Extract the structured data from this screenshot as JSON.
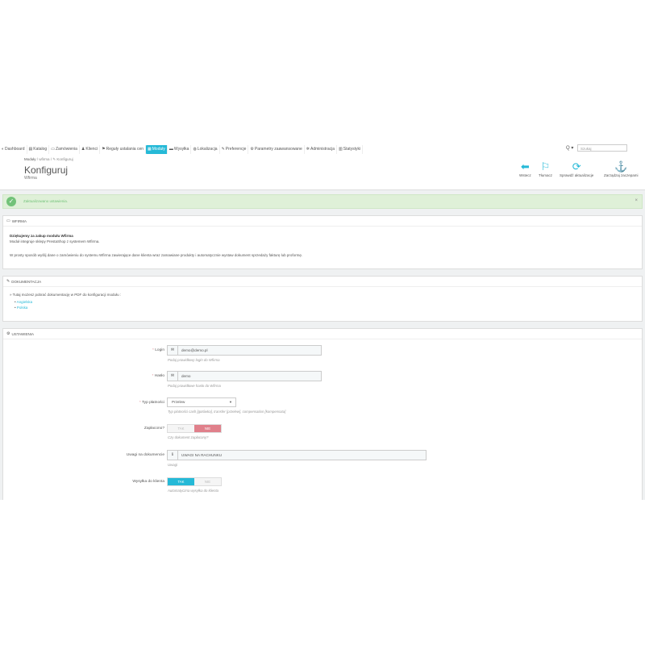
{
  "nav": {
    "items": [
      {
        "icon": "dashboard-icon",
        "glyph": "◐",
        "label": "Dashboard"
      },
      {
        "icon": "catalog-icon",
        "glyph": "▤",
        "label": "Katalog"
      },
      {
        "icon": "orders-icon",
        "glyph": "▭",
        "label": "Zamówienia"
      },
      {
        "icon": "customers-icon",
        "glyph": "♟",
        "label": "Klienci"
      },
      {
        "icon": "price-rules-icon",
        "glyph": "⚑",
        "label": "Reguły ustalania cen"
      },
      {
        "icon": "modules-icon",
        "glyph": "▦",
        "label": "Moduły"
      },
      {
        "icon": "shipping-icon",
        "glyph": "▬",
        "label": "Wysyłka"
      },
      {
        "icon": "localization-icon",
        "glyph": "◍",
        "label": "Lokalizacja"
      },
      {
        "icon": "preferences-icon",
        "glyph": "✎",
        "label": "Preferencje"
      },
      {
        "icon": "advanced-params-icon",
        "glyph": "⚙",
        "label": "Parametry zaawansowane"
      },
      {
        "icon": "administration-icon",
        "glyph": "✲",
        "label": "Administracja"
      },
      {
        "icon": "stats-icon",
        "glyph": "▥",
        "label": "Statystyki"
      }
    ],
    "active_index": 5,
    "search_placeholder": "Szukaj",
    "search_dropdown": "Q ▾"
  },
  "header": {
    "breadcrumb": [
      "Moduły",
      "wfirma",
      "Konfiguruj"
    ],
    "breadcrumb_sep": "/",
    "title": "Konfiguruj",
    "subtitle": "Wfirma",
    "toolbar": [
      {
        "icon": "back-icon",
        "glyph": "⬅",
        "label": "Wstecz"
      },
      {
        "icon": "translate-icon",
        "glyph": "⚐",
        "label": "Tłumacz"
      },
      {
        "icon": "refresh-icon",
        "glyph": "⟳",
        "label": "Sprawdź aktualizacje"
      },
      {
        "icon": "anchor-icon",
        "glyph": "⚓",
        "label": "Zarządzaj zaczepami"
      }
    ]
  },
  "alert": {
    "message": "Zaktualizowano ustawienia.",
    "close": "×",
    "check": "✓"
  },
  "panel_wfirma": {
    "title": "WFIRMA",
    "icon_glyph": "▭",
    "thanks": "Dziękujemy za zakup modułu Wfirma",
    "line1": "Moduł integruje sklepy PrestaShop z systemem Wfirma.",
    "line2": "W prosty sposób wyślij dane o zamówieniu do systemu Wfirma zawierające dane klienta wraz zamawiane produkty i automatycznie wystaw dokument sprzedaży fakturę lub proformę."
  },
  "panel_docs": {
    "title": "DOKUMENTACJA",
    "icon_glyph": "✎",
    "intro": "» Tutaj możesz pobrać dokumentację w PDF do konfiguracji modułu :",
    "links": [
      "Angielska",
      "Polska"
    ]
  },
  "panel_settings": {
    "title": "USTAWIENIA",
    "icon_glyph": "⚙",
    "fields": {
      "login": {
        "label": "Login",
        "value": "demo@demo.pl",
        "help": "Podaj prawidłowy login do Wfirma",
        "addon": "✉"
      },
      "password": {
        "label": "Hasło",
        "value": "demo",
        "help": "Podaj prawidłowe hasło do Wfirma",
        "addon": "✉"
      },
      "payment_type": {
        "label": "Typ płatności",
        "value": "Przelew",
        "help": "Typ płatności cash [gotówka], transfer [przelew], compensation [kompensata]"
      },
      "paid": {
        "label": "Zapłacono?",
        "yes": "TAK",
        "no": "NIE",
        "selected": "NIE",
        "help": "Czy dokument zapłacony?"
      },
      "notes": {
        "label": "Uwagi na dokumencie",
        "value": "UWAGI NA RACHUNKU",
        "help": "Uwagi",
        "addon": "ℹ"
      },
      "send_to_client": {
        "label": "Wysyłka do klienta",
        "yes": "TAK",
        "no": "NIE",
        "selected": "TAK",
        "help": "Automatyczna wysyłka do klienta"
      }
    },
    "required_mark": "*"
  }
}
